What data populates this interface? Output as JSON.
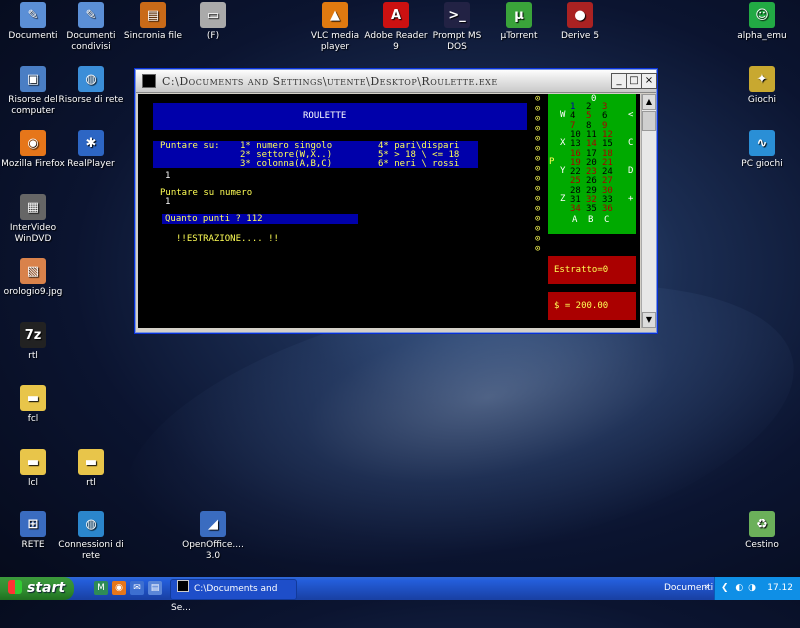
{
  "desktop": {
    "icons": [
      {
        "label": "Documenti",
        "glyph": "✎",
        "color": "#5b8fd6"
      },
      {
        "label": "Documenti condivisi",
        "glyph": "✎",
        "color": "#5b8fd6"
      },
      {
        "label": "Sincronia file",
        "glyph": "▤",
        "color": "#c96a18"
      },
      {
        "label": "(F)",
        "glyph": "▭",
        "color": "#aaaaaa"
      },
      {
        "label": "VLC media player",
        "glyph": "▲",
        "color": "#e07a10"
      },
      {
        "label": "Adobe Reader 9",
        "glyph": "A",
        "color": "#cc1111"
      },
      {
        "label": "Prompt MS DOS",
        "glyph": ">_",
        "color": "#222244"
      },
      {
        "label": "µTorrent",
        "glyph": "µ",
        "color": "#3aa33a"
      },
      {
        "label": "Derive 5",
        "glyph": "●",
        "color": "#aa2222"
      },
      {
        "label": "alpha_emu",
        "glyph": "☺",
        "color": "#22aa44"
      },
      {
        "label": "Risorse del computer",
        "glyph": "▣",
        "color": "#4a7ec4"
      },
      {
        "label": "Risorse di rete",
        "glyph": "◍",
        "color": "#3b8ed8"
      },
      {
        "label": "Giochi",
        "glyph": "✦",
        "color": "#c8a830"
      },
      {
        "label": "Mozilla Firefox",
        "glyph": "◉",
        "color": "#e6761a"
      },
      {
        "label": "RealPlayer",
        "glyph": "✱",
        "color": "#2d66c4"
      },
      {
        "label": "PC giochi",
        "glyph": "∿",
        "color": "#2a8fd6"
      },
      {
        "label": "InterVideo WinDVD",
        "glyph": "▦",
        "color": "#666666"
      },
      {
        "label": "orologio9.jpg",
        "glyph": "▧",
        "color": "#d9824b"
      },
      {
        "label": "rtl",
        "glyph": "7z",
        "color": "#222222"
      },
      {
        "label": "fcl",
        "glyph": "▬",
        "color": "#e8c54a"
      },
      {
        "label": "lcl",
        "glyph": "▬",
        "color": "#e8c54a"
      },
      {
        "label": "rtl",
        "glyph": "▬",
        "color": "#e8c54a"
      },
      {
        "label": "RETE",
        "glyph": "⊞",
        "color": "#3a6cc0"
      },
      {
        "label": "Connessioni di rete",
        "glyph": "◍",
        "color": "#2b86cc"
      },
      {
        "label": "OpenOffice.... 3.0",
        "glyph": "◢",
        "color": "#3a6cc0"
      },
      {
        "label": "Cestino",
        "glyph": "♻",
        "color": "#6bb05a"
      }
    ]
  },
  "window": {
    "title": "C:\\Documents and Settings\\utente\\Desktop\\Roulette.exe",
    "btn_minimize": "_",
    "btn_maximize": "□",
    "btn_close": "×"
  },
  "console": {
    "header": "ROULETTE",
    "menu_label": "Puntare su:",
    "opt1": "1*  numero singolo",
    "opt2": "2*  settore(W,X..)",
    "opt3": "3*  colonna(A,B,C)",
    "opt4": "4*  pari\\dispari",
    "opt5": "5*  > 18 \\ <= 18",
    "opt6": "6*  neri \\ rossi",
    "choice1": "1",
    "prompt2": "Puntare su numero",
    "choice2": "1",
    "ask_points": "Quanto punti ? 112",
    "draw": "!!ESTRAZIONE.... !!",
    "extracted": "Estratto=0",
    "money": "$ = 200.00"
  },
  "roulette_table": {
    "zero": "0",
    "sectors_left": [
      "W",
      "X",
      "Y",
      "Z"
    ],
    "sectors_right": [
      "<",
      "C",
      "D",
      "+"
    ],
    "sector_p": "P",
    "columns": [
      "A",
      "B",
      "C"
    ],
    "rows": [
      [
        "1",
        "2",
        "3"
      ],
      [
        "4",
        "5",
        "6"
      ],
      [
        "7",
        "8",
        "9"
      ],
      [
        "10",
        "11",
        "12"
      ],
      [
        "13",
        "14",
        "15"
      ],
      [
        "16",
        "17",
        "18"
      ],
      [
        "19",
        "20",
        "21"
      ],
      [
        "22",
        "23",
        "24"
      ],
      [
        "25",
        "26",
        "27"
      ],
      [
        "28",
        "29",
        "30"
      ],
      [
        "31",
        "32",
        "33"
      ],
      [
        "34",
        "35",
        "36"
      ]
    ],
    "red_numbers": [
      "3",
      "5",
      "7",
      "9",
      "12",
      "14",
      "16",
      "18",
      "19",
      "21",
      "23",
      "25",
      "27",
      "30",
      "32",
      "34",
      "36"
    ]
  },
  "taskbar": {
    "start_label": "start",
    "quicklaunch": [
      "M",
      "◉",
      "✉",
      "▤"
    ],
    "task_label": "C:\\Documents and Se...",
    "tray_label": "Documenti",
    "clock": "17.12"
  }
}
